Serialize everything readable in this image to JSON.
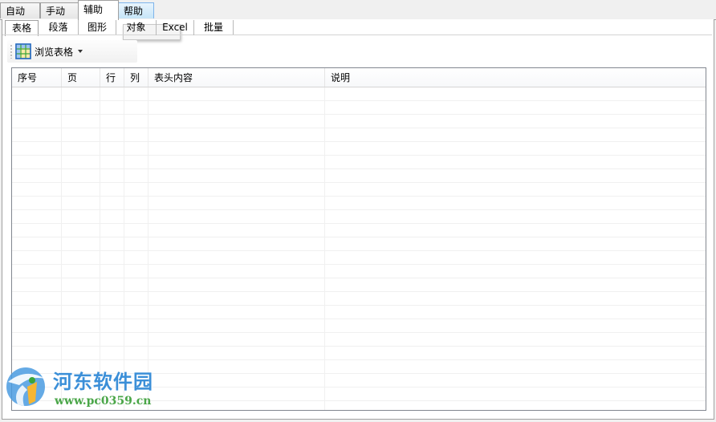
{
  "main_tabs": [
    {
      "label": "自动"
    },
    {
      "label": "手动"
    },
    {
      "label": "辅助"
    },
    {
      "label": "帮助"
    }
  ],
  "active_main_tab": "辅助",
  "sub_tabs": [
    {
      "label": "表格"
    },
    {
      "label": "段落"
    },
    {
      "label": "图形"
    },
    {
      "label": "对象"
    },
    {
      "label": "Excel"
    },
    {
      "label": "批量"
    }
  ],
  "active_sub_tab": "表格",
  "toolbar": {
    "browse_label": "浏览表格",
    "browse_icon": "table-grid-icon"
  },
  "grid": {
    "columns": [
      {
        "label": "序号"
      },
      {
        "label": "页"
      },
      {
        "label": "行"
      },
      {
        "label": "列"
      },
      {
        "label": "表头内容"
      },
      {
        "label": "说明"
      }
    ],
    "rows": []
  },
  "watermark": {
    "title": "河东软件园",
    "url": "www.pc0359.cn"
  },
  "colors": {
    "accent": "#3b8fd8",
    "hover_tab": "#c6e5f8",
    "watermark_green": "#4aa648"
  }
}
